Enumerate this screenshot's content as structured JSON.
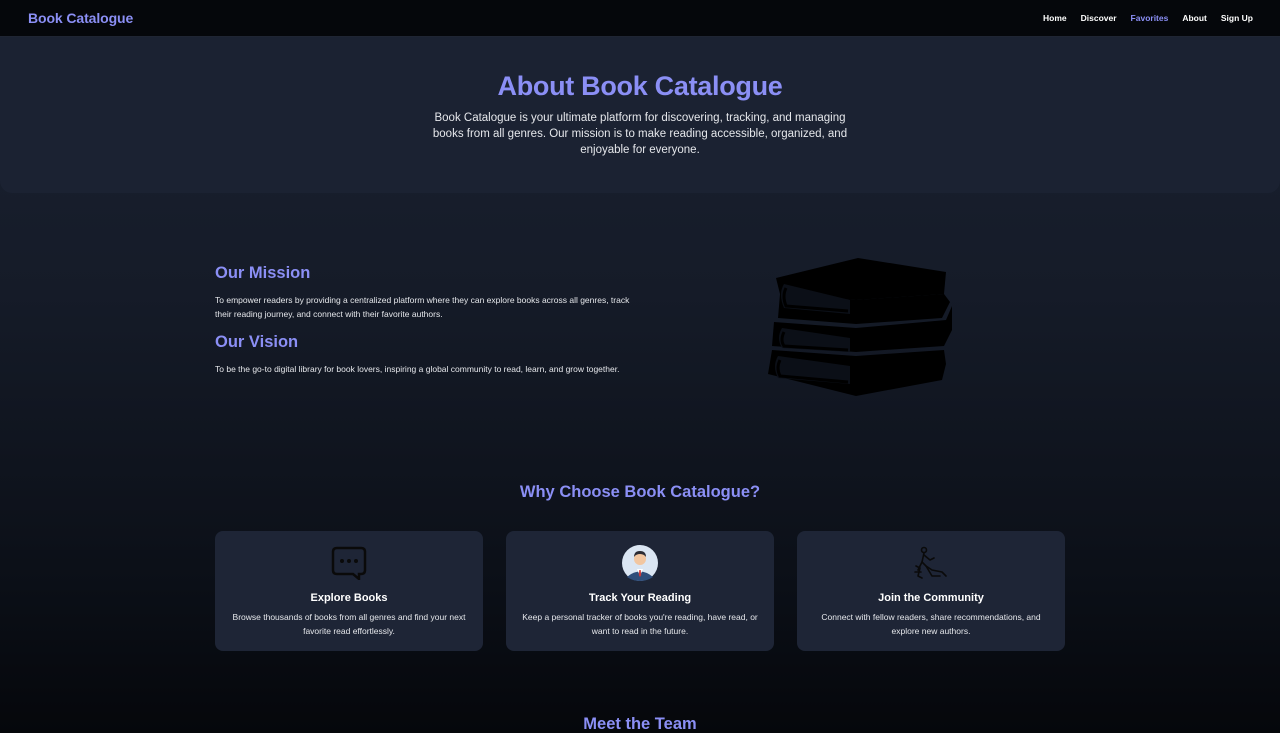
{
  "nav": {
    "brand": "Book Catalogue",
    "links": [
      "Home",
      "Discover",
      "Favorites",
      "About",
      "Sign Up"
    ],
    "active": "Favorites"
  },
  "hero": {
    "title": "About Book Catalogue",
    "description": "Book Catalogue is your ultimate platform for discovering, tracking, and managing books from all genres. Our mission is to make reading accessible, organized, and enjoyable for everyone."
  },
  "mission": {
    "title": "Our Mission",
    "text": "To empower readers by providing a centralized platform where they can explore books across all genres, track their reading journey, and connect with their favorite authors."
  },
  "vision": {
    "title": "Our Vision",
    "text": "To be the go-to digital library for book lovers, inspiring a global community to read, learn, and grow together."
  },
  "why": {
    "title": "Why Choose Book Catalogue?",
    "cards": [
      {
        "icon": "chat-bubble-icon",
        "title": "Explore Books",
        "text": "Browse thousands of books from all genres and find your next favorite read effortlessly."
      },
      {
        "icon": "person-avatar-icon",
        "title": "Track Your Reading",
        "text": "Keep a personal tracker of books you're reading, have read, or want to read in the future."
      },
      {
        "icon": "community-icon",
        "title": "Join the Community",
        "text": "Connect with fellow readers, share recommendations, and explore new authors."
      }
    ]
  },
  "team": {
    "title": "Meet the Team"
  },
  "colors": {
    "accent": "#8b8ff5",
    "background": "#151b28",
    "card": "#1e2536",
    "navbar": "#05070b"
  }
}
